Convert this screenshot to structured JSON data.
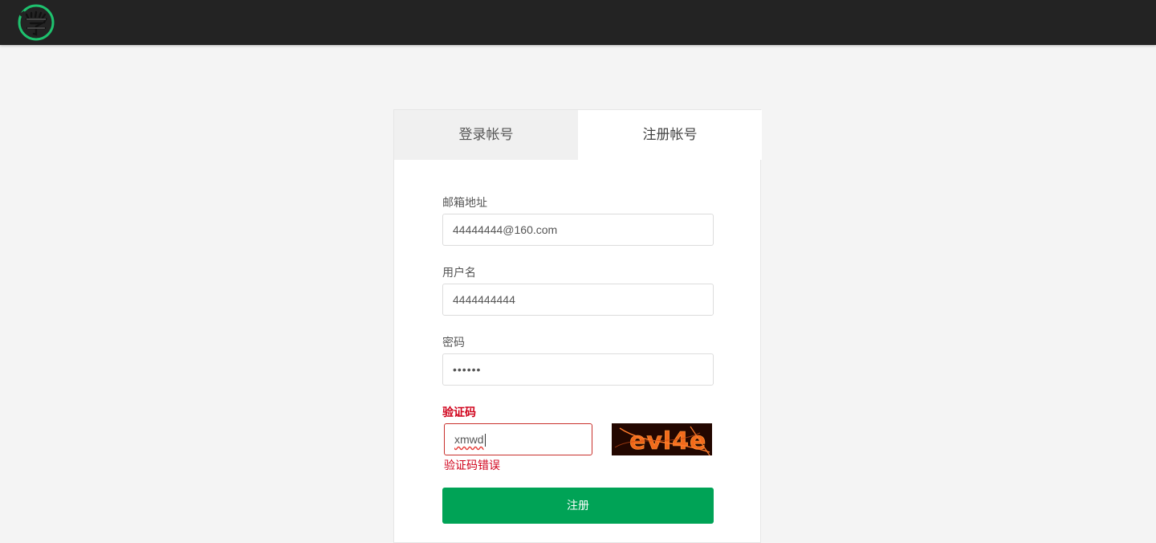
{
  "tabs": {
    "login": "登录帐号",
    "register": "注册帐号"
  },
  "form": {
    "email": {
      "label": "邮箱地址",
      "value": "44444444@160.com"
    },
    "username": {
      "label": "用户名",
      "value": "4444444444"
    },
    "password": {
      "label": "密码",
      "value": "••••••"
    },
    "captcha": {
      "label": "验证码",
      "value": "xmwd",
      "error": "验证码错误",
      "image_text": "evl4e"
    },
    "submit_label": "注册"
  },
  "colors": {
    "topbar": "#232323",
    "accent": "#00a356",
    "error": "#d0021b",
    "logo_ring": "#1ec26e"
  }
}
